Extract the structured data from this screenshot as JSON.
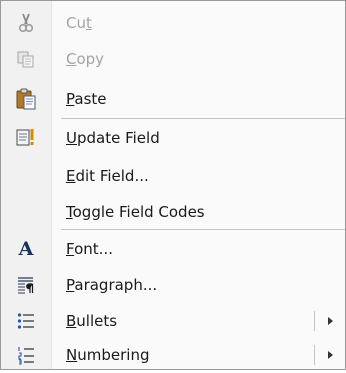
{
  "menu": {
    "items": [
      {
        "pre": "Cu",
        "mnemonic": "t",
        "post": "",
        "disabled": true,
        "icon": "scissors-icon"
      },
      {
        "pre": "",
        "mnemonic": "C",
        "post": "opy",
        "disabled": true,
        "icon": "copy-icon"
      },
      {
        "pre": "",
        "mnemonic": "P",
        "post": "aste",
        "disabled": false,
        "icon": "clipboard-icon"
      },
      {
        "pre": "",
        "mnemonic": "U",
        "post": "pdate Field",
        "disabled": false,
        "icon": "update-field-icon"
      },
      {
        "pre": "",
        "mnemonic": "E",
        "post": "dit Field...",
        "disabled": false,
        "icon": ""
      },
      {
        "pre": "",
        "mnemonic": "T",
        "post": "oggle Field Codes",
        "disabled": false,
        "icon": ""
      },
      {
        "pre": "",
        "mnemonic": "F",
        "post": "ont...",
        "disabled": false,
        "icon": "font-icon",
        "icon_text": "A"
      },
      {
        "pre": "",
        "mnemonic": "P",
        "post": "aragraph...",
        "disabled": false,
        "icon": "paragraph-icon"
      },
      {
        "pre": "",
        "mnemonic": "B",
        "post": "ullets",
        "disabled": false,
        "icon": "bullets-icon",
        "submenu": true
      },
      {
        "pre": "",
        "mnemonic": "N",
        "post": "umbering",
        "disabled": false,
        "icon": "numbering-icon",
        "submenu": true
      }
    ]
  },
  "colors": {
    "disabled_text": "#a4a4a4",
    "text": "#1a1a1a",
    "gutter": "#f1f1f1",
    "separator": "#c5c5c5"
  }
}
